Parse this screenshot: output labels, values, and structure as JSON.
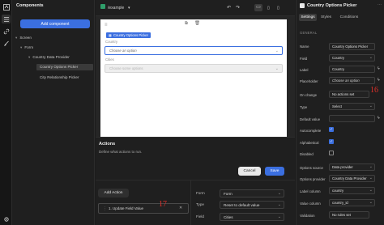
{
  "left_panel": {
    "title": "Components",
    "add_button": "Add component"
  },
  "tree": {
    "screen": "Screen",
    "form": "Form",
    "country_data_provider": "Country Data Provider",
    "country_options_picker": "Country Options Picker",
    "city_relationship_picker": "City Relationship Picker"
  },
  "topbar": {
    "path": "/example"
  },
  "canvas": {
    "picker_tag": "Country Options Picker",
    "country_label": "Country",
    "country_placeholder": "Choose an option",
    "cities_label": "Cities",
    "cities_placeholder": "Choose some options"
  },
  "actions": {
    "title": "Actions",
    "description": "Define what actions to run.",
    "cancel": "Cancel",
    "save": "Save",
    "add_action": "Add Action",
    "item": "1. Update Field Value",
    "annotation": "17",
    "props": [
      {
        "label": "Form",
        "value": "Form"
      },
      {
        "label": "Type",
        "value": "Reset to default value"
      },
      {
        "label": "Field",
        "value": "Cities"
      }
    ]
  },
  "inspector": {
    "title": "Country Options Picker",
    "tabs": [
      "Settings",
      "Styles",
      "Conditions"
    ],
    "section": "GENERAL",
    "annotation": "16",
    "rows": {
      "name_label": "Name",
      "name_value": "Country Options Picker",
      "field_label": "Field",
      "field_value": "Country",
      "label_label": "Label",
      "label_value": "Country",
      "placeholder_label": "Placeholder",
      "placeholder_value": "Choose an option",
      "onchange_label": "On change",
      "onchange_value": "No actions set",
      "type_label": "Type",
      "type_value": "Select",
      "default_label": "Default value",
      "autocomplete_label": "Autocomplete",
      "alphabetical_label": "Alphabetical",
      "disabled_label": "Disabled",
      "options_source_label": "Options source",
      "options_source_value": "Data provider",
      "options_provider_label": "Options provider",
      "options_provider_value": "Country Data Provider",
      "label_column_label": "Label column",
      "label_column_value": "country",
      "value_column_label": "Value column",
      "value_column_value": "country_id",
      "validation_label": "Validation",
      "validation_value": "No rules set"
    }
  },
  "colors": {
    "accent": "#3b6fe0",
    "annotation": "#e0302a"
  }
}
